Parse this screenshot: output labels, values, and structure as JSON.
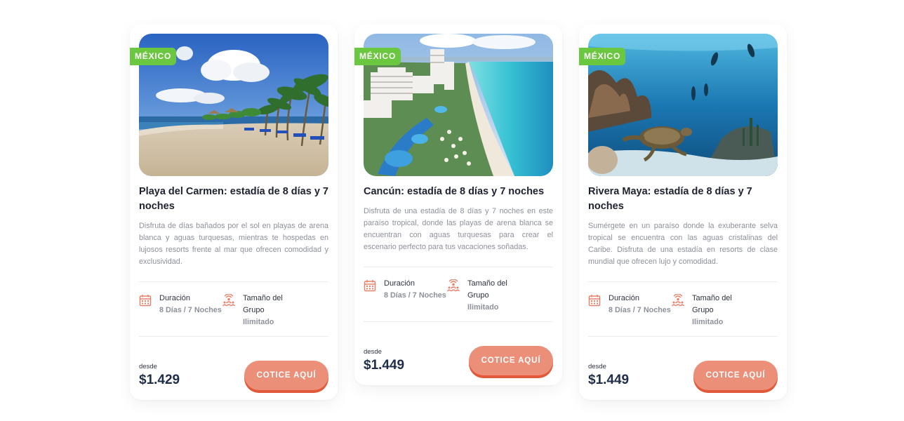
{
  "cards": [
    {
      "badge": "MÉXICO",
      "title": "Playa del Carmen: estadía de 8 días y 7 noches",
      "description": "Disfruta de días bañados por el sol en playas de arena blanca y aguas turquesas, mientras te hospedas en lujosos resorts frente al mar que ofrecen comodidad y exclusividad.",
      "duration_label": "Duración",
      "duration_value": "8 Días / 7 Noches",
      "group_label": "Tamaño del Grupo",
      "group_value": "Ilimitado",
      "from_label": "desde",
      "price": "$1.429",
      "cta": "COTICE AQUÍ"
    },
    {
      "badge": "MÉXICO",
      "title": "Cancún: estadía de 8 días y 7 noches",
      "description": "Disfruta de una estadía de 8 días y 7 noches en este paraíso tropical, donde las playas de arena blanca se encuentran con aguas turquesas para crear el escenario perfecto para tus vacaciones soñadas.",
      "duration_label": "Duración",
      "duration_value": "8 Días / 7 Noches",
      "group_label": "Tamaño del Grupo",
      "group_value": "Ilimitado",
      "from_label": "desde",
      "price": "$1.449",
      "cta": "COTICE AQUÍ"
    },
    {
      "badge": "MÉXICO",
      "title": "Rivera Maya: estadía de 8 días y 7 noches",
      "description": "Sumérgete en un paraíso donde la exuberante selva tropical se encuentra con las aguas cristalinas del Caribe. Disfruta de una estadía en resorts de clase mundial que ofrecen lujo y comodidad.",
      "duration_label": "Duración",
      "duration_value": "8 Días / 7 Noches",
      "group_label": "Tamaño del Grupo",
      "group_value": "Ilimitado",
      "from_label": "desde",
      "price": "$1.449",
      "cta": "COTICE AQUÍ"
    }
  ],
  "icons": {
    "duration": "calendar-icon",
    "group": "group-signal-icon"
  },
  "colors": {
    "badge": "#6ac73f",
    "button": "#eb8f79",
    "button_shadow": "#e2583a",
    "price": "#1f2d48",
    "icon": "#e8826c"
  }
}
